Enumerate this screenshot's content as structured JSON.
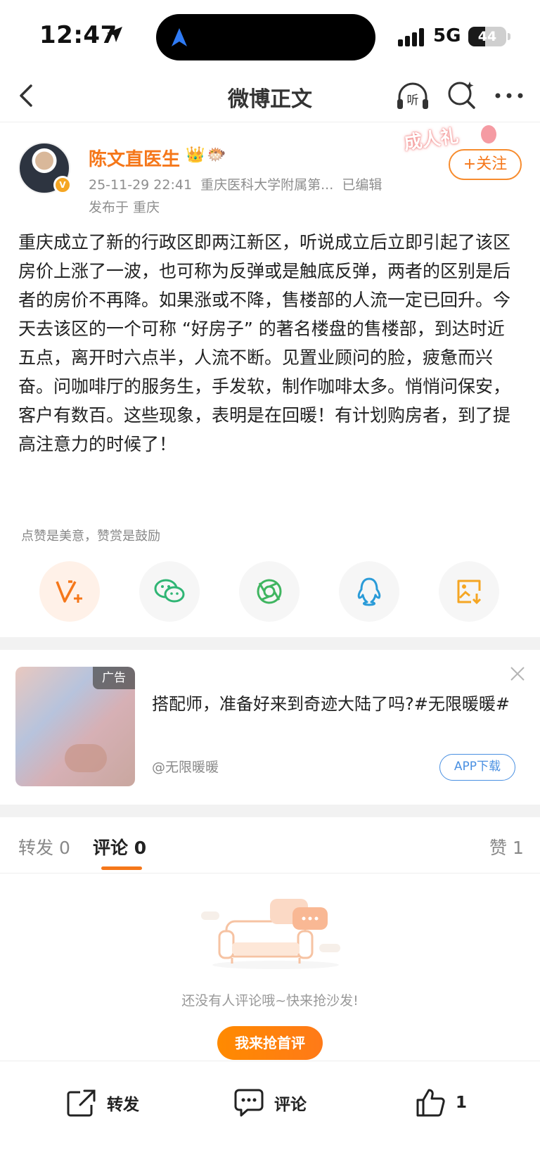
{
  "status_bar": {
    "time": "12:47",
    "network": "5G",
    "battery": "44",
    "battery_level_percent": 44
  },
  "nav": {
    "title": "微博正文",
    "listen_label": "听"
  },
  "author": {
    "name": "陈文直医生",
    "date": "25-11-29 22:41",
    "source": "重庆医科大学附属第...",
    "edited": "已编辑",
    "location": "发布于 重庆",
    "ribbon": "成人礼",
    "follow_label": "+关注"
  },
  "post": {
    "text": "重庆成立了新的行政区即两江新区，听说成立后立即引起了该区房价上涨了一波，也可称为反弹或是触底反弹，两者的区别是后者的房价不再降。如果涨或不降，售楼部的人流一定已回升。今天去该区的一个可称 “好房子” 的著名楼盘的售楼部，到达时近五点，离开时六点半，人流不断。见置业顾问的脸，疲惫而兴奋。问咖啡厅的服务生，手发软，制作咖啡太多。悄悄问保安，客户有数百。这些现象，表明是在回暖！有计划购房者，到了提高注意力的时候了！"
  },
  "praise_hint": "点赞是美意，赞赏是鼓励",
  "share_icons": [
    "reward-icon",
    "wechat-icon",
    "moments-icon",
    "qq-icon",
    "save-image-icon"
  ],
  "ad": {
    "badge": "广告",
    "title": "搭配师，准备好来到奇迹大陆了吗?#无限暖暖#",
    "source": "@无限暖暖",
    "download_label": "APP下载"
  },
  "tabs": {
    "repost": "转发 0",
    "comment": "评论 0",
    "like": "赞 1"
  },
  "empty": {
    "text": "还没有人评论哦~快来抢沙发!",
    "button": "我来抢首评"
  },
  "bottom_bar": {
    "repost": "转发",
    "comment": "评论",
    "like_count": "1"
  },
  "colors": {
    "accent": "#f5771a",
    "link_blue": "#4a90e2"
  }
}
